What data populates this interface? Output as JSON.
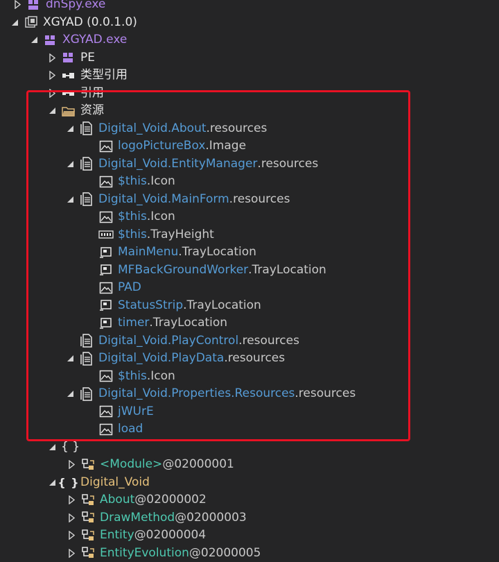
{
  "tree": {
    "top_partial": {
      "label": "dnSpy.exe"
    },
    "assembly": {
      "label": "XGYAD (0.0.1.0)"
    },
    "module": {
      "label": "XGYAD.exe"
    },
    "pe": {
      "label": "PE"
    },
    "type_refs": {
      "label": "类型引用"
    },
    "refs": {
      "label": "引用"
    },
    "resources_folder": {
      "label": "资源"
    },
    "resources": [
      {
        "ns": "Digital_Void.About",
        "suffix": ".resources",
        "children": [
          {
            "icon": "image-icon",
            "name": "logoPictureBox",
            "prop": ".Image"
          }
        ]
      },
      {
        "ns": "Digital_Void.EntityManager",
        "suffix": ".resources",
        "children": [
          {
            "icon": "image-icon",
            "name": "$this",
            "prop": ".Icon"
          }
        ]
      },
      {
        "ns": "Digital_Void.MainForm",
        "suffix": ".resources",
        "children": [
          {
            "icon": "image-icon",
            "name": "$this",
            "prop": ".Icon"
          },
          {
            "icon": "binary-icon",
            "name": "$this",
            "prop": ".TrayHeight"
          },
          {
            "icon": "location-icon",
            "name": "MainMenu",
            "prop": ".TrayLocation"
          },
          {
            "icon": "location-icon",
            "name": "MFBackGroundWorker",
            "prop": ".TrayLocation"
          },
          {
            "icon": "image-icon",
            "name": "PAD",
            "prop": ""
          },
          {
            "icon": "location-icon",
            "name": "StatusStrip",
            "prop": ".TrayLocation"
          },
          {
            "icon": "location-icon",
            "name": "timer",
            "prop": ".TrayLocation"
          }
        ]
      },
      {
        "ns": "Digital_Void.PlayControl",
        "suffix": ".resources",
        "children": []
      },
      {
        "ns": "Digital_Void.PlayData",
        "suffix": ".resources",
        "children": [
          {
            "icon": "image-icon",
            "name": "$this",
            "prop": ".Icon"
          }
        ]
      },
      {
        "ns": "Digital_Void.Properties.Resources",
        "suffix": ".resources",
        "children": [
          {
            "icon": "image-icon",
            "name": "jWUrE",
            "prop": ""
          },
          {
            "icon": "image-icon",
            "name": "load",
            "prop": ""
          }
        ]
      }
    ],
    "empty_ns": {
      "label": "{ }"
    },
    "module_type": {
      "name": "<Module>",
      "token": " @02000001"
    },
    "namespace": {
      "label": "Digital_Void"
    },
    "types": [
      {
        "name": "About",
        "token": " @02000002"
      },
      {
        "name": "DrawMethod",
        "token": " @02000003"
      },
      {
        "name": "Entity",
        "token": " @02000004"
      },
      {
        "name": "EntityEvolution",
        "token": " @02000005"
      }
    ]
  },
  "colors": {
    "background": "#252526",
    "highlight_border": "#e81123",
    "namespace_text": "#569cd6",
    "type_text": "#4ec9b0",
    "namespace_folder": "#e5c07b"
  }
}
